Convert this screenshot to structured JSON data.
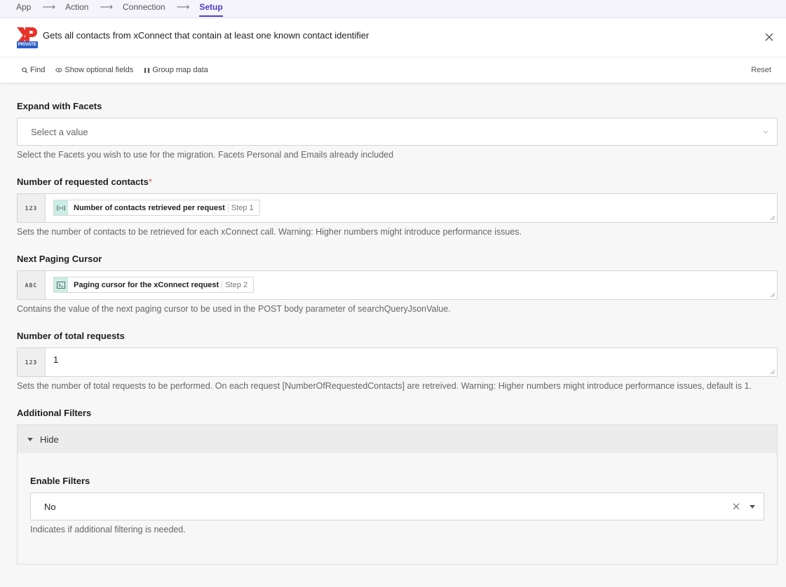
{
  "steps": [
    "App",
    "Action",
    "Connection",
    "Setup"
  ],
  "active_step": "Setup",
  "header": {
    "badge": "PRIVATE",
    "title": "Gets all contacts from xConnect that contain at least one known contact identifier"
  },
  "toolbar": {
    "find": "Find",
    "optional": "Show optional fields",
    "group": "Group map data",
    "reset": "Reset"
  },
  "fields": {
    "facets": {
      "label": "Expand with Facets",
      "placeholder": "Select a value",
      "hint": "Select the Facets you wish to use for the migration. Facets Personal and Emails already included"
    },
    "requested": {
      "label": "Number of requested contacts",
      "required": "*",
      "type": "123",
      "pill_label": "Number of contacts retrieved per request",
      "pill_step": "Step 1",
      "hint": "Sets the number of contacts to be retrieved for each xConnect call. Warning: Higher numbers might introduce performance issues."
    },
    "cursor": {
      "label": "Next Paging Cursor",
      "type": "ABC",
      "pill_label": "Paging cursor for the xConnect request",
      "pill_step": "Step 2",
      "hint": "Contains the value of the next paging cursor to be used in the POST body parameter of searchQueryJsonValue."
    },
    "total": {
      "label": "Number of total requests",
      "type": "123",
      "value": "1",
      "hint": "Sets the number of total requests to be performed. On each request [NumberOfRequestedContacts] are retreived. Warning: Higher numbers might introduce performance issues, default is 1."
    },
    "filters": {
      "label": "Additional Filters",
      "toggle": "Hide",
      "enable": {
        "label": "Enable Filters",
        "value": "No",
        "hint": "Indicates if additional filtering is needed."
      }
    }
  },
  "colors": {
    "accent": "#4b3fc9",
    "brand_red": "#e8332a",
    "badge_blue": "#2c5ec8",
    "pill_teal": "#c9eee6"
  }
}
